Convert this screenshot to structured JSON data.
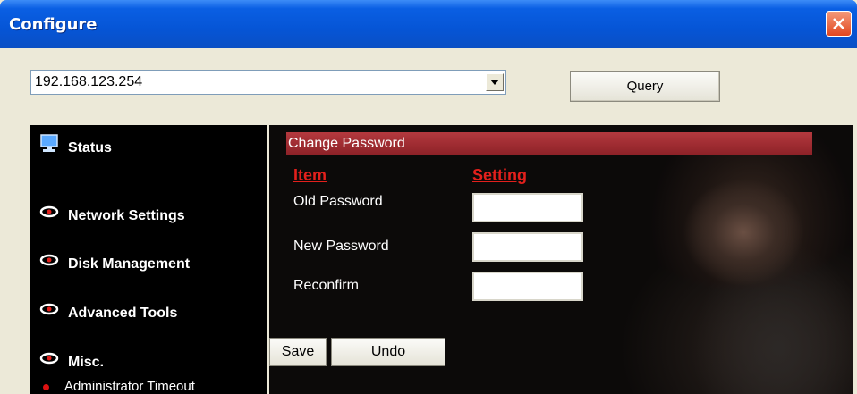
{
  "window": {
    "title": "Configure"
  },
  "address": {
    "value": "192.168.123.254"
  },
  "toolbar": {
    "query_label": "Query"
  },
  "sidebar": {
    "items": [
      {
        "label": "Status",
        "icon": "monitor-icon"
      },
      {
        "label": "Network Settings",
        "icon": "eye-icon"
      },
      {
        "label": "Disk Management",
        "icon": "eye-icon"
      },
      {
        "label": "Advanced Tools",
        "icon": "eye-icon"
      },
      {
        "label": "Misc.",
        "icon": "eye-icon"
      }
    ],
    "sub_items": [
      {
        "label": "Administrator Timeout"
      }
    ]
  },
  "panel": {
    "section_title": "Change Password",
    "col_item": "Item",
    "col_setting": "Setting",
    "rows": [
      {
        "label": "Old Password",
        "value": ""
      },
      {
        "label": "New Password",
        "value": ""
      },
      {
        "label": "Reconfirm",
        "value": ""
      }
    ],
    "save_label": "Save",
    "undo_label": "Undo"
  },
  "colors": {
    "titlebar": "#0655d6",
    "section_header": "#b4393e",
    "column_header": "#e3201c",
    "sidebar_bg": "#000000",
    "window_bg": "#ece9d8"
  }
}
